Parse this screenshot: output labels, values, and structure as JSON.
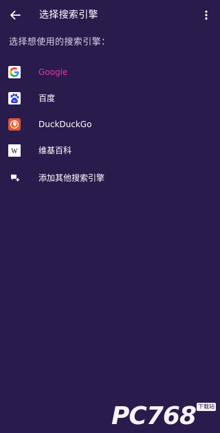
{
  "appbar": {
    "title": "选择搜索引擎",
    "back_icon": "arrow-left-icon",
    "menu_icon": "more-vert-icon"
  },
  "subtitle": "选择想使用的搜索引擎：",
  "engines": [
    {
      "label": "Google",
      "icon": "google-icon",
      "selected": true
    },
    {
      "label": "百度",
      "icon": "baidu-icon",
      "selected": false
    },
    {
      "label": "DuckDuckGo",
      "icon": "duckduckgo-icon",
      "selected": false
    },
    {
      "label": "维基百科",
      "icon": "wikipedia-icon",
      "selected": false
    }
  ],
  "add_engine": {
    "label": "添加其他搜索引擎",
    "icon": "add-search-engine-icon"
  },
  "watermark": {
    "text": "PC768",
    "badge": "下载站"
  },
  "colors": {
    "background": "#2a1b4d",
    "selected": "#e0389c",
    "text": "#ffffff"
  }
}
